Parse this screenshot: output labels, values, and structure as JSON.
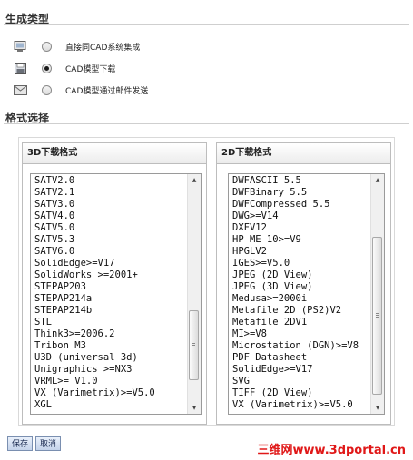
{
  "sections": {
    "generate_type": "生成类型",
    "format_select": "格式选择"
  },
  "gen_types": [
    {
      "label": "直接同CAD系统集成",
      "icon": "computer-icon",
      "checked": false
    },
    {
      "label": "CAD模型下载",
      "icon": "floppy-disk-icon",
      "checked": true
    },
    {
      "label": "CAD模型通过邮件发送",
      "icon": "envelope-icon",
      "checked": false
    }
  ],
  "panel_3d": {
    "title": "3D下载格式",
    "items": [
      "SATV2.0",
      "SATV2.1",
      "SATV3.0",
      "SATV4.0",
      "SATV5.0",
      "SATV5.3",
      "SATV6.0",
      "SolidEdge>=V17",
      "SolidWorks >=2001+",
      "STEPAP203",
      "STEPAP214a",
      "STEPAP214b",
      "STL",
      "Think3>=2006.2",
      "Tribon M3",
      "U3D (universal 3d)",
      "Unigraphics >=NX3",
      "VRML>= V1.0",
      "VX (Varimetrix)>=V5.0",
      "XGL"
    ]
  },
  "panel_2d": {
    "title": "2D下载格式",
    "items": [
      "DWFASCII 5.5",
      "DWFBinary 5.5",
      "DWFCompressed 5.5",
      "DWG>=V14",
      "DXFV12",
      "HP ME 10>=V9",
      "HPGLV2",
      "IGES>=V5.0",
      "JPEG (2D View)",
      "JPEG (3D View)",
      "Medusa>=2000i",
      "Metafile 2D (PS2)V2",
      "Metafile 2DV1",
      "MI>=V8",
      "Microstation (DGN)>=V8",
      "PDF Datasheet",
      "SolidEdge>=V17",
      "SVG",
      "TIFF (2D View)",
      "VX (Varimetrix)>=V5.0"
    ]
  },
  "buttons": {
    "save": "保存",
    "cancel": "取消"
  },
  "watermark": "三维网www.3dportal.cn"
}
